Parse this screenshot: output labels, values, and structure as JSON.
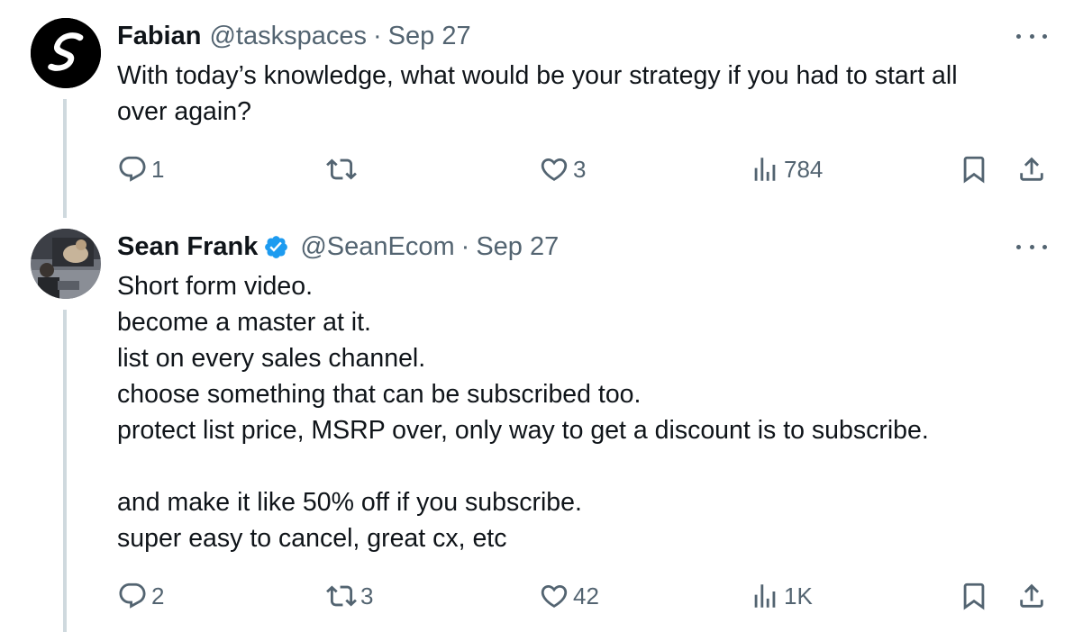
{
  "tweets": [
    {
      "name": "Fabian",
      "handle": "@taskspaces",
      "separator": "·",
      "date": "Sep 27",
      "text_lines": [
        "With today’s knowledge, what would be your strategy if you had to start all",
        "over again?"
      ],
      "verified": false,
      "counts": {
        "replies": "1",
        "retweets": "",
        "likes": "3",
        "views": "784"
      }
    },
    {
      "name": "Sean Frank",
      "handle": "@SeanEcom",
      "separator": "·",
      "date": "Sep 27",
      "text_lines": [
        "Short form video.",
        "become a master at it.",
        "list on every sales channel.",
        "choose something that can be subscribed too.",
        "protect list price, MSRP over, only way to get a discount is to subscribe.",
        "",
        "and make it like 50% off if you subscribe.",
        "super easy to cancel, great cx, etc"
      ],
      "verified": true,
      "counts": {
        "replies": "2",
        "retweets": "3",
        "likes": "42",
        "views": "1K"
      }
    }
  ],
  "colors": {
    "text": "#0f1419",
    "secondary": "#536471",
    "verified": "#1d9bf0",
    "thread_line": "#cfd9de"
  },
  "icons": {
    "more": "more-horizontal-icon",
    "reply": "reply-icon",
    "retweet": "retweet-icon",
    "like": "heart-icon",
    "views": "views-icon",
    "bookmark": "bookmark-icon",
    "share": "share-icon",
    "verified": "verified-badge-icon"
  }
}
